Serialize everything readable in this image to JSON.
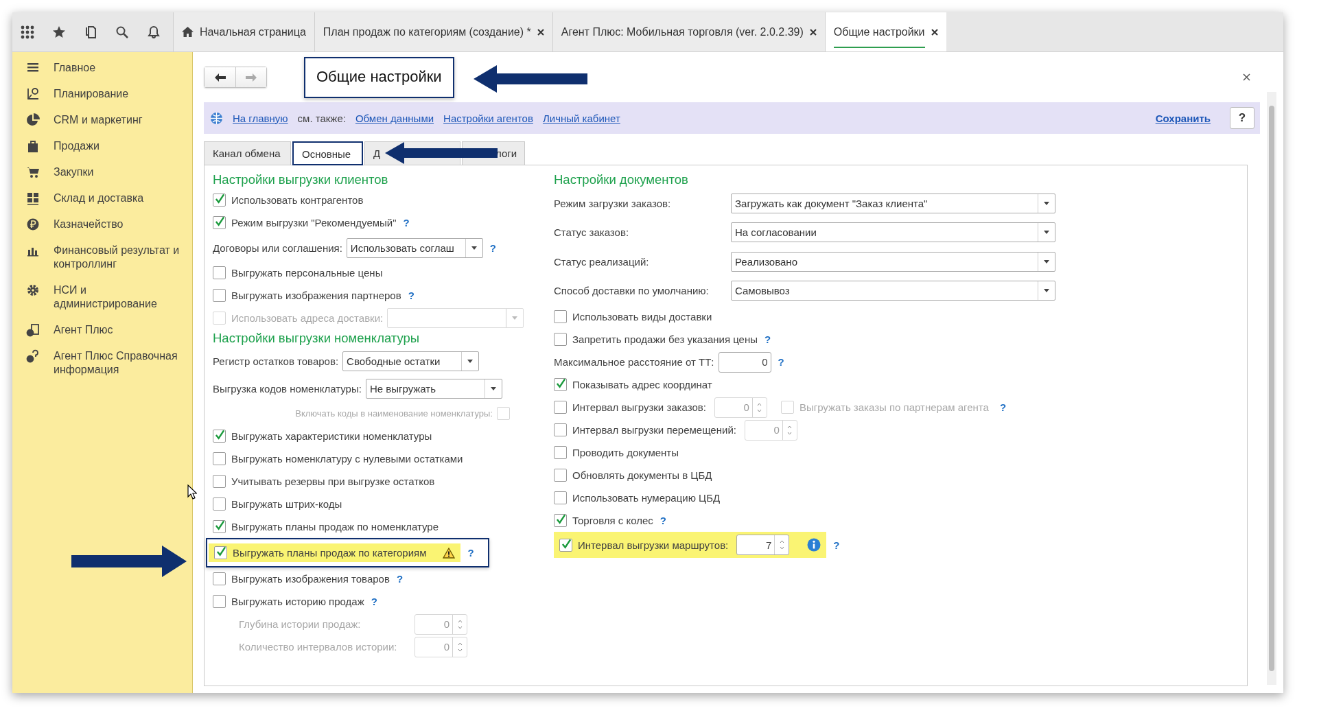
{
  "open_tabs": [
    {
      "kind": "home",
      "label": "Начальная страница",
      "selected": false
    },
    {
      "kind": "doc",
      "label": "План продаж по категориям (создание) *",
      "selected": false
    },
    {
      "kind": "doc",
      "label": "Агент Плюс: Мобильная торговля (ver. 2.0.2.39)",
      "selected": false
    },
    {
      "kind": "doc",
      "label": "Общие настройки",
      "selected": true
    }
  ],
  "sidebar": {
    "items": [
      {
        "label": "Главное"
      },
      {
        "label": "Планирование"
      },
      {
        "label": "CRM и маркетинг"
      },
      {
        "label": "Продажи"
      },
      {
        "label": "Закупки"
      },
      {
        "label": "Склад и доставка"
      },
      {
        "label": "Казначейство"
      },
      {
        "label": "Финансовый результат и контроллинг"
      },
      {
        "label": "НСИ и администрирование"
      },
      {
        "label": "Агент Плюс"
      },
      {
        "label": "Агент Плюс Справочная информация"
      }
    ]
  },
  "form": {
    "title": "Общие настройки",
    "command_bar": {
      "home_link": "На главную",
      "see_also": "см. также:",
      "links": [
        "Обмен данными",
        "Настройки агентов",
        "Личный кабинет"
      ],
      "save": "Сохранить",
      "help": "?"
    },
    "tabs": [
      {
        "label": "Канал обмена",
        "selected": false
      },
      {
        "label": "Основные",
        "selected": true
      },
      {
        "label": "Д",
        "selected": false
      },
      {
        "label": "логи",
        "selected": false
      }
    ],
    "columns": [
      {
        "sections": [
          {
            "heading": "Настройки выгрузки клиентов",
            "rows": [
              {
                "kind": "check",
                "label": "Использовать контрагентов",
                "checked": true
              },
              {
                "kind": "check",
                "label": "Режим выгрузки \"Рекомендуемый\"",
                "checked": true,
                "help": "?"
              },
              {
                "kind": "select",
                "label": "Договоры или соглашения:",
                "value": "Использовать соглаш",
                "help": "?"
              },
              {
                "kind": "check",
                "label": "Выгружать персональные цены",
                "checked": false
              },
              {
                "kind": "check",
                "label": "Выгружать изображения партнеров",
                "checked": false,
                "help": "?"
              },
              {
                "kind": "check_select",
                "label": "Использовать адреса доставки:",
                "checked": false,
                "disabled": true
              }
            ]
          },
          {
            "heading": "Настройки выгрузки номенклатуры",
            "rows": [
              {
                "kind": "select",
                "label": "Регистр остатков товаров:",
                "value": "Свободные остатки"
              },
              {
                "kind": "select",
                "label": "Выгрузка кодов номенклатуры:",
                "value": "Не выгружать"
              },
              {
                "kind": "right_check",
                "label": "Включать коды в наименование номенклатуры:",
                "checked": false,
                "disabled": true
              },
              {
                "kind": "check",
                "label": "Выгружать характеристики номенклатуры",
                "checked": true
              },
              {
                "kind": "check",
                "label": "Выгружать номенклатуру с нулевыми остатками",
                "checked": false
              },
              {
                "kind": "check",
                "label": "Учитывать резервы при выгрузке остатков",
                "checked": false
              },
              {
                "kind": "check",
                "label": "Выгружать штрих-коды",
                "checked": false
              },
              {
                "kind": "check",
                "label": "Выгружать планы продаж по номенклатуре",
                "checked": true
              },
              {
                "kind": "check",
                "label": "Выгружать планы продаж по категориям",
                "checked": true,
                "highlighted": true,
                "outlined": true,
                "warning": true,
                "help": "?"
              },
              {
                "kind": "check",
                "label": "Выгружать изображения товаров",
                "checked": false,
                "help": "?"
              },
              {
                "kind": "check",
                "label": "Выгружать историю продаж",
                "checked": false,
                "help": "?"
              },
              {
                "kind": "sub_number",
                "label": "Глубина истории продаж:",
                "value": "0",
                "disabled": true,
                "spin": true
              },
              {
                "kind": "sub_number",
                "label": "Количество интервалов истории:",
                "value": "0",
                "disabled": true,
                "spin": true
              }
            ]
          }
        ]
      },
      {
        "sections": [
          {
            "heading": "Настройки документов",
            "rows": [
              {
                "kind": "select",
                "label": "Режим загрузки заказов:",
                "value": "Загружать как документ \"Заказ клиента\""
              },
              {
                "kind": "select",
                "label": "Статус заказов:",
                "value": "На согласовании"
              },
              {
                "kind": "select",
                "label": "Статус реализаций:",
                "value": "Реализовано"
              },
              {
                "kind": "select",
                "label": "Способ доставки по умолчанию:",
                "value": "Самовывоз"
              },
              {
                "kind": "check",
                "label": "Использовать виды доставки",
                "checked": false
              },
              {
                "kind": "check",
                "label": "Запретить продажи без указания цены",
                "checked": false,
                "help": "?"
              },
              {
                "kind": "number",
                "label": "Максимальное расстояние от ТТ:",
                "value": "0",
                "disabled": false,
                "spin": false,
                "help": "?"
              },
              {
                "kind": "check",
                "label": "Показывать адрес координат",
                "checked": true
              },
              {
                "kind": "check_number",
                "label": "Интервал выгрузки заказов:",
                "checked": false,
                "value": "0",
                "disabled": true,
                "spin": true,
                "extra": {
                  "label": "Выгружать заказы по партнерам агента",
                  "checked": false,
                  "disabled": true
                },
                "help": "?"
              },
              {
                "kind": "check_number",
                "label": "Интервал выгрузки перемещений:",
                "checked": false,
                "value": "0",
                "disabled": true,
                "spin": true
              },
              {
                "kind": "check",
                "label": "Проводить документы",
                "checked": false
              },
              {
                "kind": "check",
                "label": "Обновлять документы в ЦБД",
                "checked": false
              },
              {
                "kind": "check",
                "label": "Использовать нумерацию ЦБД",
                "checked": false
              },
              {
                "kind": "check",
                "label": "Торговля с колес",
                "checked": true,
                "help": "?"
              },
              {
                "kind": "check_number",
                "label": "Интервал выгрузки маршрутов:",
                "checked": true,
                "value": "7",
                "disabled": false,
                "spin": true,
                "highlighted": true,
                "info": true,
                "help": "?"
              }
            ]
          }
        ]
      }
    ]
  }
}
